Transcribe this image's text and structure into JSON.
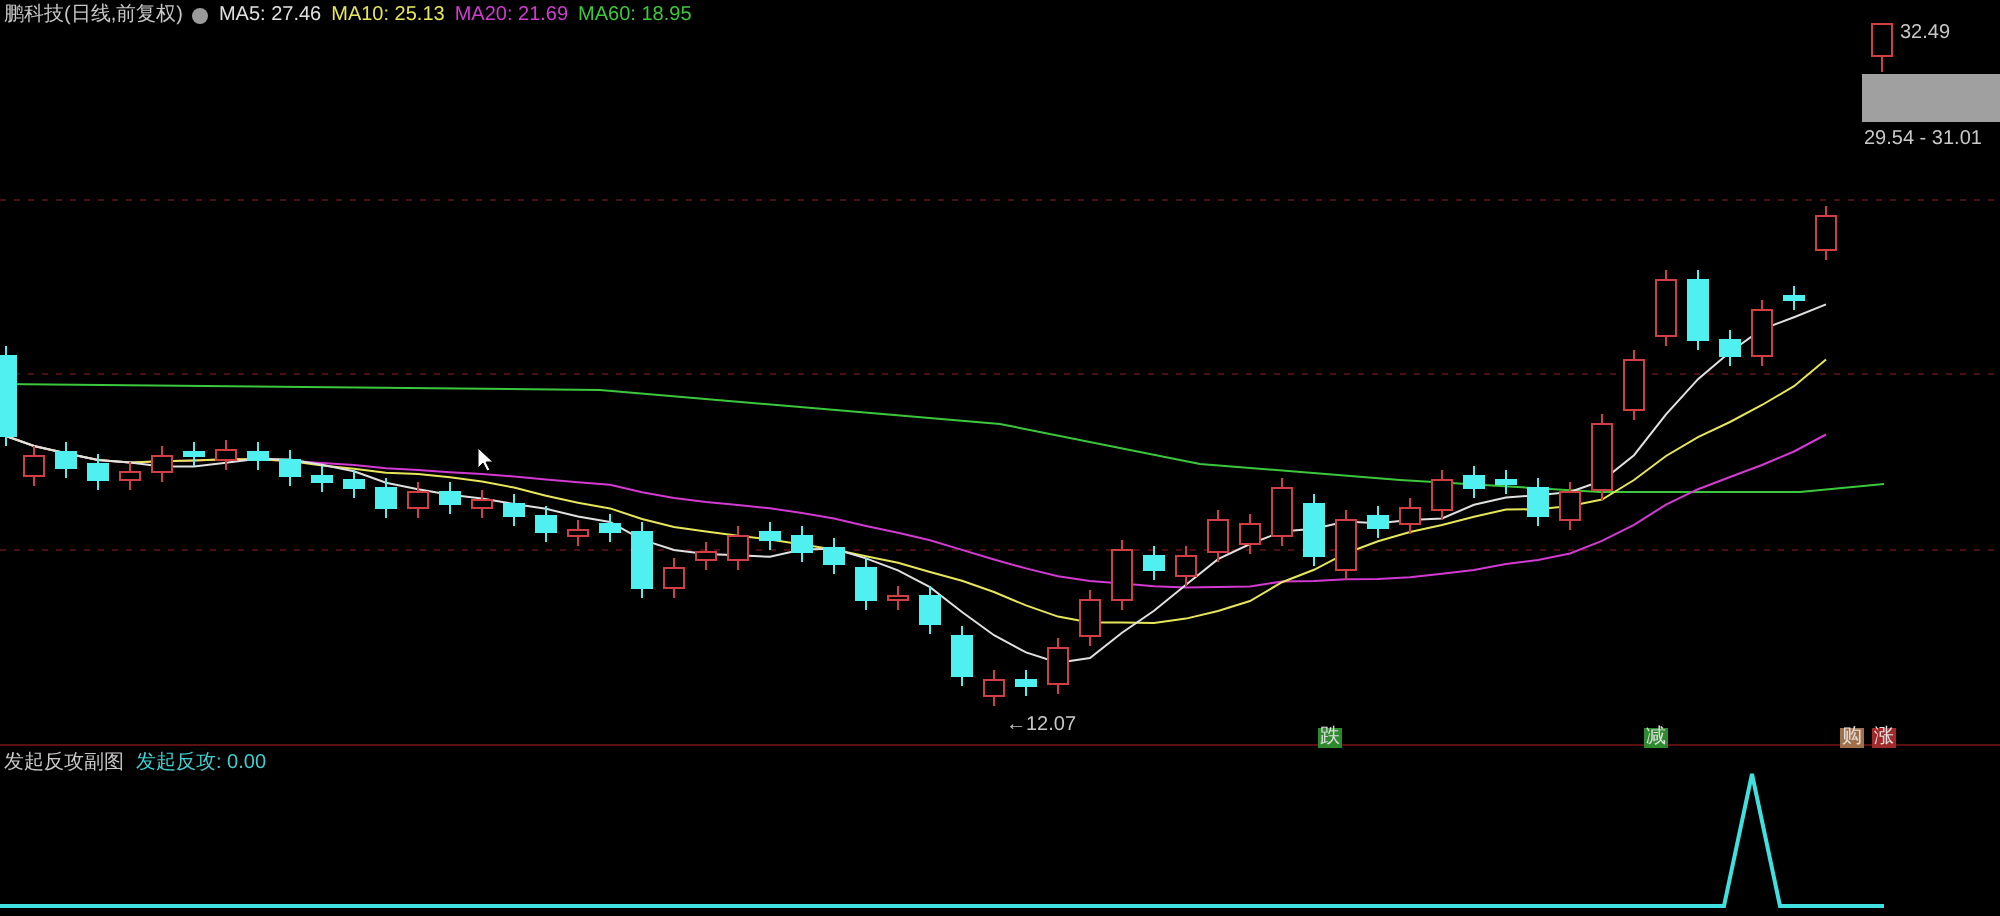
{
  "header": {
    "title": "鹏科技(日线,前复权)",
    "ma": [
      {
        "label": "MA5: 27.46",
        "color": "#e0e0e0"
      },
      {
        "label": "MA10: 25.13",
        "color": "#e6e65a"
      },
      {
        "label": "MA20: 21.69",
        "color": "#d23ad2"
      },
      {
        "label": "MA60: 18.95",
        "color": "#3cc83c"
      }
    ]
  },
  "price_labels": {
    "high": "32.49",
    "low": "←12.07",
    "range": "29.54 - 31.01"
  },
  "signals": [
    {
      "label": "跌",
      "color": "#2f8a2f"
    },
    {
      "label": "减",
      "color": "#2f8a2f"
    },
    {
      "label": "购",
      "color": "#a0704a"
    },
    {
      "label": "涨",
      "color": "#a02a2a"
    }
  ],
  "indicator": {
    "title": "发起反攻副图",
    "reading": "发起反攻: 0.00"
  }
}
